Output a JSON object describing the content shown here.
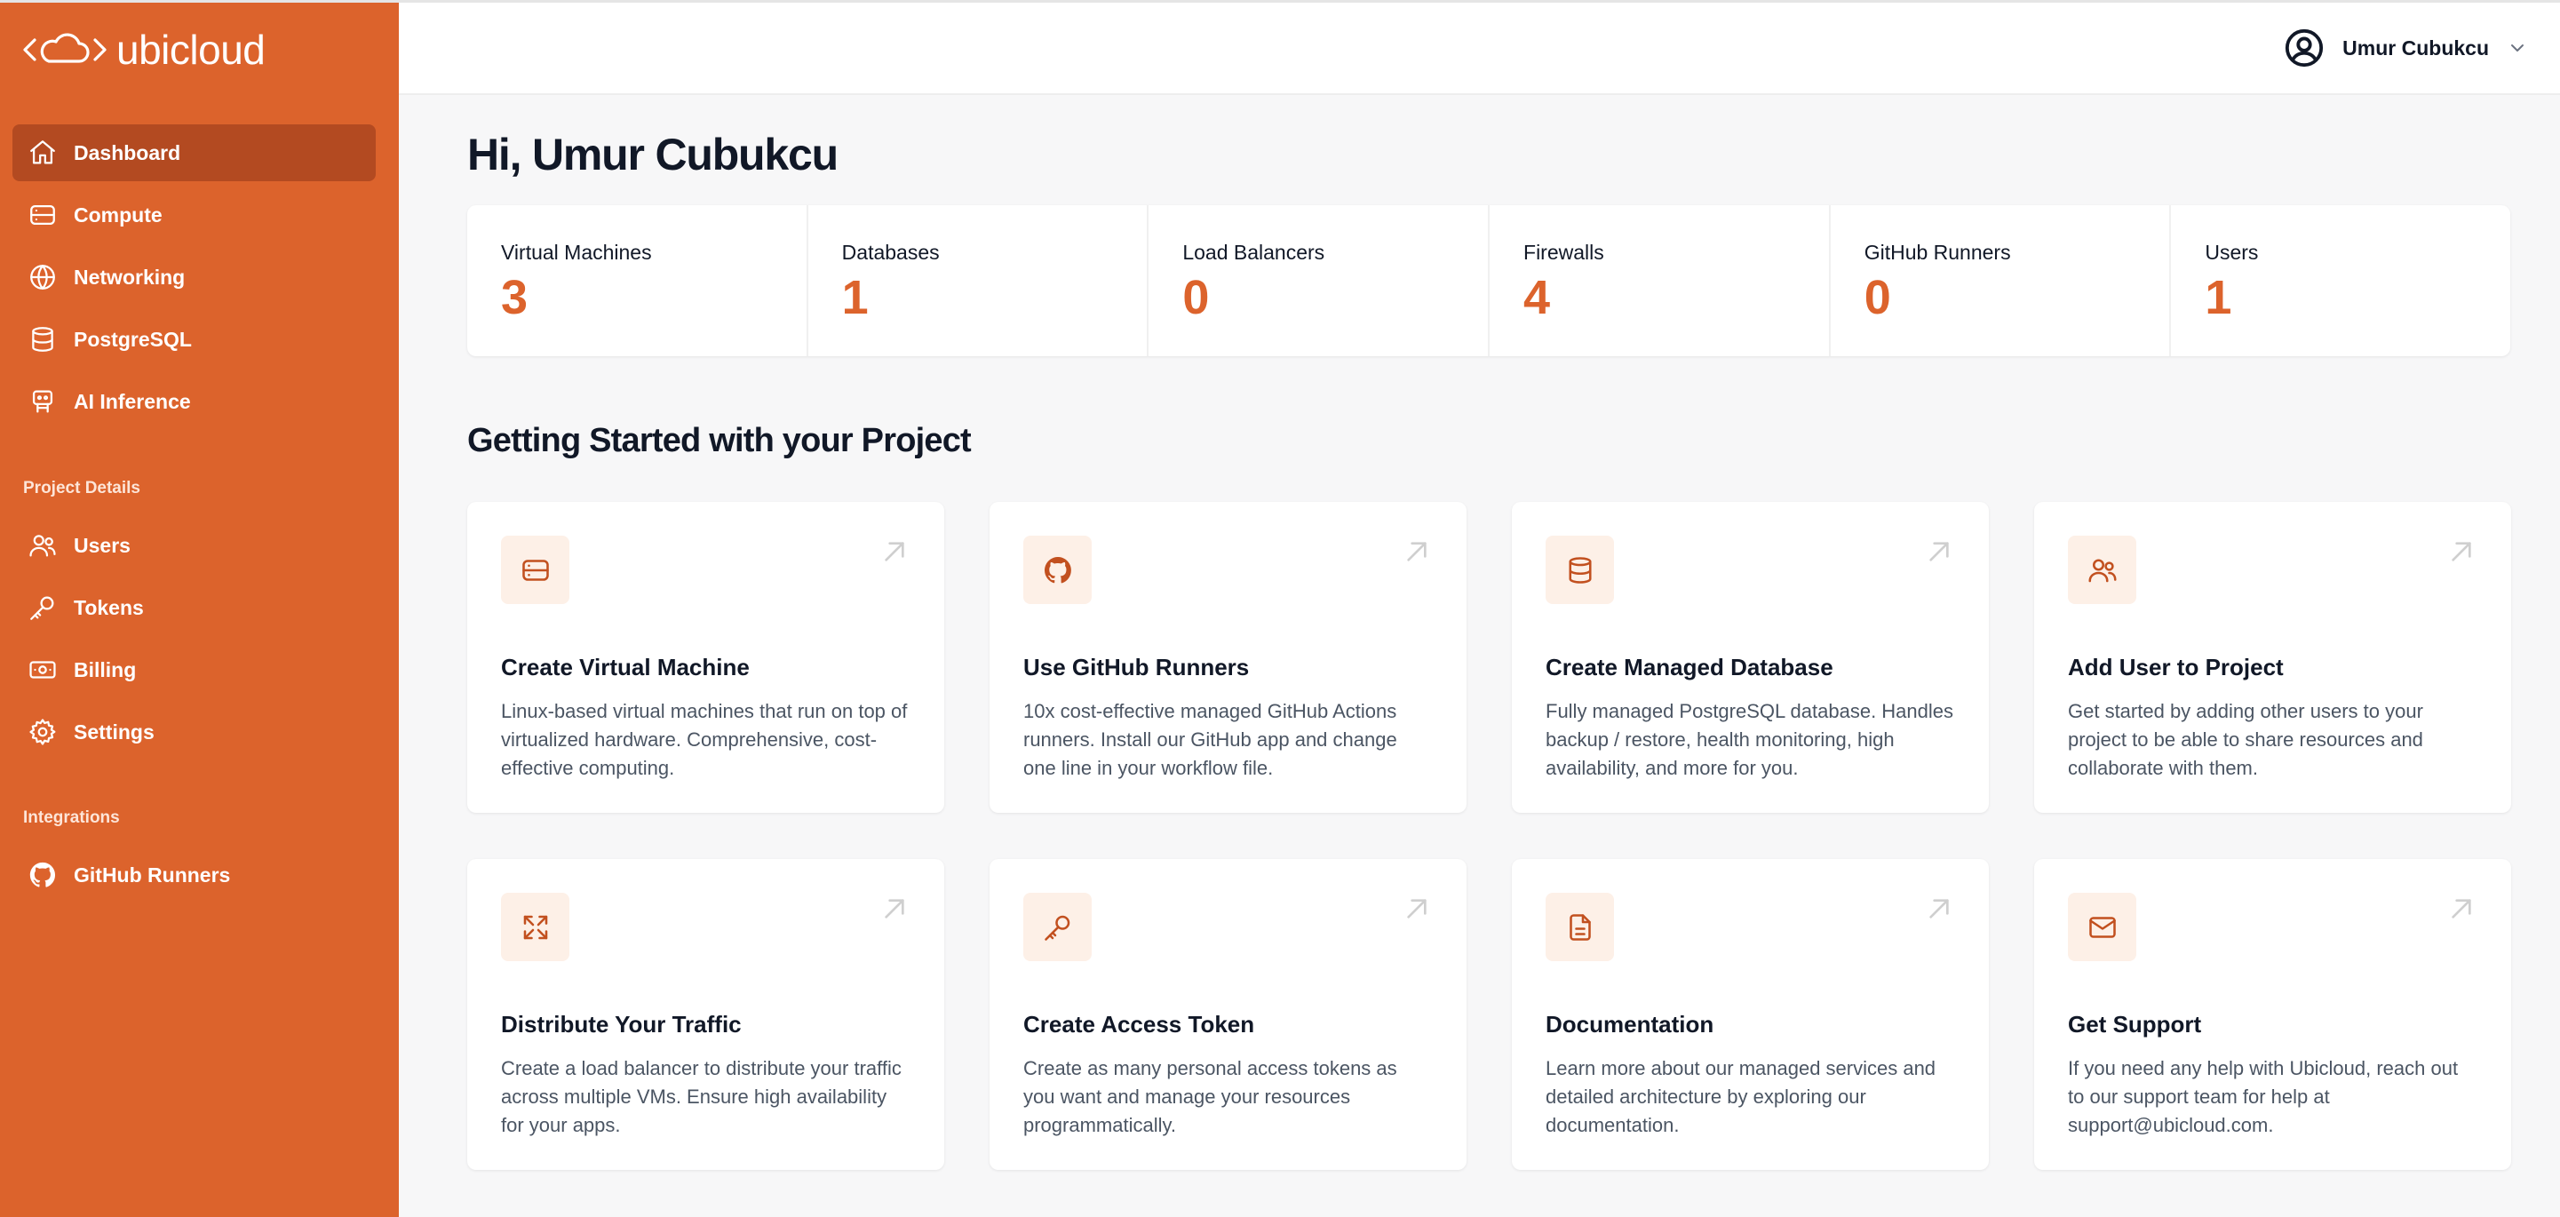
{
  "brand": {
    "name": "ubicloud",
    "accent": "#dc632c"
  },
  "sidebar": {
    "main_items": [
      {
        "label": "Dashboard",
        "icon": "home-icon",
        "active": true
      },
      {
        "label": "Compute",
        "icon": "server-icon"
      },
      {
        "label": "Networking",
        "icon": "globe-icon"
      },
      {
        "label": "PostgreSQL",
        "icon": "database-icon"
      },
      {
        "label": "AI Inference",
        "icon": "robot-icon"
      }
    ],
    "project_section_label": "Project Details",
    "project_items": [
      {
        "label": "Users",
        "icon": "users-icon"
      },
      {
        "label": "Tokens",
        "icon": "key-icon"
      },
      {
        "label": "Billing",
        "icon": "banknote-icon"
      },
      {
        "label": "Settings",
        "icon": "gear-icon"
      }
    ],
    "integrations_section_label": "Integrations",
    "integration_items": [
      {
        "label": "GitHub Runners",
        "icon": "github-icon"
      }
    ]
  },
  "header": {
    "user_name": "Umur Cubukcu"
  },
  "main": {
    "greeting": "Hi, Umur Cubukcu",
    "stats": [
      {
        "label": "Virtual Machines",
        "value": "3"
      },
      {
        "label": "Databases",
        "value": "1"
      },
      {
        "label": "Load Balancers",
        "value": "0"
      },
      {
        "label": "Firewalls",
        "value": "4"
      },
      {
        "label": "GitHub Runners",
        "value": "0"
      },
      {
        "label": "Users",
        "value": "1"
      }
    ],
    "section_title": "Getting Started with your Project",
    "cards": [
      {
        "title": "Create Virtual Machine",
        "desc": "Linux-based virtual machines that run on top of virtualized hardware. Comprehensive, cost-effective computing.",
        "icon": "server-icon"
      },
      {
        "title": "Use GitHub Runners",
        "desc": "10x cost-effective managed GitHub Actions runners. Install our GitHub app and change one line in your workflow file.",
        "icon": "github-icon"
      },
      {
        "title": "Create Managed Database",
        "desc": "Fully managed PostgreSQL database. Handles backup / restore, health monitoring, high availability, and more for you.",
        "icon": "database-icon"
      },
      {
        "title": "Add User to Project",
        "desc": "Get started by adding other users to your project to be able to share resources and collaborate with them.",
        "icon": "users-icon"
      },
      {
        "title": "Distribute Your Traffic",
        "desc": "Create a load balancer to distribute your traffic across multiple VMs. Ensure high availability for your apps.",
        "icon": "expand-arrows-icon"
      },
      {
        "title": "Create Access Token",
        "desc": "Create as many personal access tokens as you want and manage your resources programmatically.",
        "icon": "key-icon"
      },
      {
        "title": "Documentation",
        "desc": "Learn more about our managed services and detailed architecture by exploring our documentation.",
        "icon": "document-icon"
      },
      {
        "title": "Get Support",
        "desc": "If you need any help with Ubicloud, reach out to our support team for help at support@ubicloud.com.",
        "icon": "envelope-icon"
      }
    ]
  }
}
